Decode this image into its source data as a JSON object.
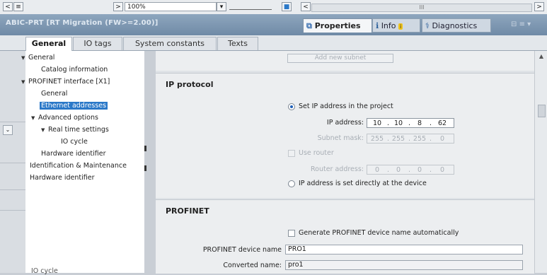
{
  "toolbar": {
    "zoom_value": "100%",
    "scroll_mid": "III"
  },
  "titlebar": {
    "title": "ABIC-PRT [RT Migration (FW>=2.00)]",
    "tabs": [
      {
        "label": "Properties"
      },
      {
        "label": "Info"
      },
      {
        "label": "Diagnostics"
      }
    ]
  },
  "tabs": [
    {
      "label": "General"
    },
    {
      "label": "IO tags"
    },
    {
      "label": "System constants"
    },
    {
      "label": "Texts"
    }
  ],
  "tree": {
    "items": [
      {
        "label": "General"
      },
      {
        "label": "Catalog information"
      },
      {
        "label": "PROFINET interface [X1]"
      },
      {
        "label": "General"
      },
      {
        "label": "Ethernet addresses"
      },
      {
        "label": "Advanced options"
      },
      {
        "label": "Real time settings"
      },
      {
        "label": "IO cycle"
      },
      {
        "label": "Hardware identifier"
      },
      {
        "label": "Identification & Maintenance"
      },
      {
        "label": "Hardware identifier"
      }
    ],
    "cut_text": "IO cycle"
  },
  "content": {
    "add_subnet": "Add new subnet",
    "ip_protocol": {
      "title": "IP protocol",
      "set_ip_in_project": "Set IP address in the project",
      "ip_address_label": "IP address:",
      "ip_address": [
        "10",
        "10",
        "8",
        "62"
      ],
      "subnet_mask_label": "Subnet mask:",
      "subnet_mask": [
        "255",
        "255",
        "255",
        "0"
      ],
      "use_router": "Use router",
      "router_address_label": "Router address:",
      "router_address": [
        "0",
        "0",
        "0",
        "0"
      ],
      "ip_set_directly": "IP address is set directly at the device"
    },
    "profinet": {
      "title": "PROFINET",
      "generate_name": "Generate PROFINET device name automatically",
      "device_name_label": "PROFINET device name",
      "device_name": "PRO1",
      "converted_name_label": "Converted name:",
      "converted_name": "pro1"
    }
  },
  "colors": {
    "titlebar": "#7c95b0",
    "selection": "#2a78c8"
  }
}
